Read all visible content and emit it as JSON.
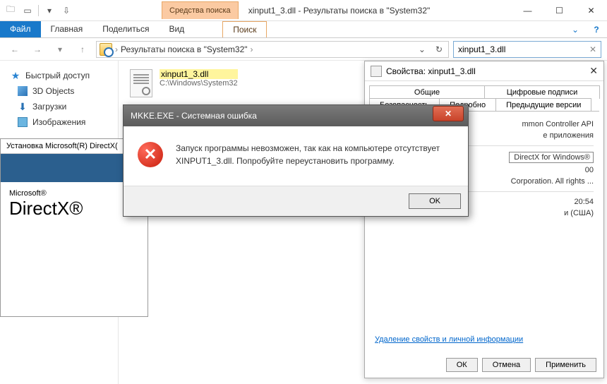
{
  "titlebar": {
    "search_tools": "Средства поиска",
    "title": "xinput1_3.dll - Результаты поиска в \"System32\""
  },
  "ribbon": {
    "file": "Файл",
    "home": "Главная",
    "share": "Поделиться",
    "view": "Вид",
    "search": "Поиск"
  },
  "address": {
    "path": "Результаты поиска в \"System32\"",
    "search_value": "xinput1_3.dll"
  },
  "sidebar": {
    "quick": "Быстрый доступ",
    "items": [
      "3D Objects",
      "Загрузки",
      "Изображения"
    ]
  },
  "file": {
    "name": "xinput1_3.dll",
    "path": "C:\\Windows\\System32"
  },
  "dx": {
    "title": "Установка Microsoft(R) DirectX(",
    "brand1": "Microsoft®",
    "brand2": "DirectX®"
  },
  "props": {
    "title": "Свойства: xinput1_3.dll",
    "tabs": {
      "general": "Общие",
      "sigs": "Цифровые подписи",
      "security": "Безопасность",
      "details": "Подробно",
      "prev": "Предыдущие версии"
    },
    "lines": {
      "l1": "mmon Controller API",
      "l2": "е приложения",
      "l3": "DirectX for Windows®",
      "l4": "00",
      "l5": "Corporation. All rights ...",
      "l6": "20:54",
      "l7": "и (США)"
    },
    "link": "Удаление свойств и личной информации",
    "ok": "ОК",
    "cancel": "Отмена",
    "apply": "Применить"
  },
  "error": {
    "title": "MKKE.EXE - Системная ошибка",
    "body": "Запуск программы невозможен, так как на компьютере отсутствует XINPUT1_3.dll. Попробуйте переустановить программу.",
    "ok": "OK"
  }
}
